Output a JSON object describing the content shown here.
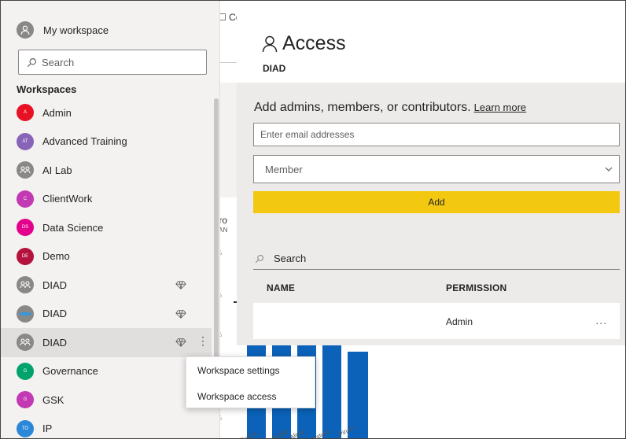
{
  "background": {
    "tab_label": "Co",
    "chart_title": "Gro",
    "chart_subtitle": "MAN",
    "pct_ticks": [
      "%",
      "%",
      "%",
      "%"
    ],
    "bar_color": "#0b62b8",
    "x_labels": [
      "Currus",
      "VanArsdel",
      "Aliqui",
      "Natura",
      "Pirum"
    ]
  },
  "sidebar": {
    "my_workspace": "My workspace",
    "search_placeholder": "Search",
    "workspaces_title": "Workspaces",
    "items": [
      {
        "label": "Admin",
        "initials": "A",
        "color": "#e81123"
      },
      {
        "label": "Advanced Training",
        "initials": "AT",
        "color": "#8764b8"
      },
      {
        "label": "AI Lab",
        "initials": "",
        "color": "#8a8886"
      },
      {
        "label": "ClientWork",
        "initials": "C",
        "color": "#c239b3"
      },
      {
        "label": "Data Science",
        "initials": "DS",
        "color": "#e3008c"
      },
      {
        "label": "Demo",
        "initials": "DE",
        "color": "#b4123d"
      },
      {
        "label": "DIAD",
        "initials": "",
        "color": "#8a8886"
      },
      {
        "label": "DIAD",
        "initials": "",
        "color": "#8a8886"
      },
      {
        "label": "DIAD",
        "initials": "",
        "color": "#8a8886"
      },
      {
        "label": "Governance",
        "initials": "G",
        "color": "#00a36c"
      },
      {
        "label": "GSK",
        "initials": "G",
        "color": "#c239b3"
      },
      {
        "label": "IP",
        "initials": "TO",
        "color": "#2b88d8"
      }
    ]
  },
  "context_menu": {
    "items": [
      "Workspace settings",
      "Workspace access"
    ]
  },
  "access_panel": {
    "title": "Access",
    "subtitle": "DIAD",
    "add_prompt": "Add admins, members, or contributors.",
    "learn_more": "Learn more",
    "email_placeholder": "Enter email addresses",
    "role_selected": "Member",
    "add_button": "Add",
    "search_placeholder": "Search",
    "col_name": "NAME",
    "col_permission": "PERMISSION",
    "rows": [
      {
        "name": "",
        "permission": "Admin",
        "more": "..."
      }
    ],
    "accent_color": "#f2c811"
  }
}
